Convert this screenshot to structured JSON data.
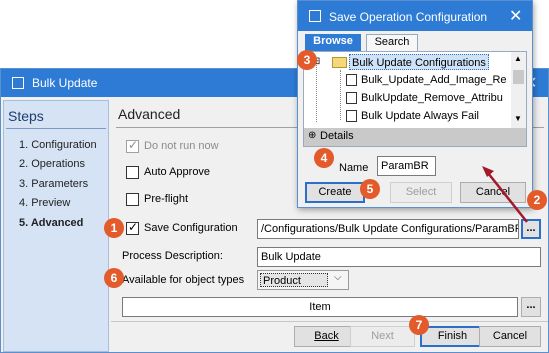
{
  "main_window": {
    "title": "Bulk Update",
    "steps": {
      "title": "Steps",
      "items": [
        "1. Configuration",
        "2. Operations",
        "3. Parameters",
        "4. Preview",
        "5. Advanced"
      ]
    },
    "section_title": "Advanced",
    "do_not_run_now": "Do not run now",
    "auto_approve": "Auto Approve",
    "pre_flight": "Pre-flight",
    "save_configuration": "Save Configuration",
    "config_path": "/Configurations/Bulk Update Configurations/ParamBR",
    "browse_button": "...",
    "process_description_label": "Process Description:",
    "process_description_value": "Bulk Update",
    "available_for_label": "Available for object types",
    "object_type_selected": "Product",
    "item_value": "Item",
    "item_browse_button": "...",
    "buttons": {
      "back": "Back",
      "next": "Next",
      "finish": "Finish",
      "cancel": "Cancel"
    }
  },
  "dialog": {
    "title": "Save Operation Configuration",
    "tabs": [
      "Browse",
      "Search"
    ],
    "tree": {
      "folder": "Bulk Update Configurations",
      "items": [
        "Bulk_Update_Add_Image_Re",
        "BulkUpdate_Remove_Attribu",
        "Bulk Update Always Fail"
      ],
      "details": "Details"
    },
    "name_label": "Name",
    "name_value": "ParamBR",
    "buttons": {
      "create": "Create",
      "select": "Select",
      "cancel": "Cancel"
    }
  },
  "markers": [
    "1",
    "2",
    "3",
    "4",
    "5",
    "6",
    "7"
  ],
  "icons": {
    "window": "window-icon",
    "close": "close-icon",
    "folder": "folder-icon",
    "file": "file-icon",
    "check": "check-icon",
    "dropdown": "chevron-down-icon"
  },
  "colors": {
    "titlebar": "#2e7bd6",
    "marker": "#e35a2b",
    "arrow": "#a3182a",
    "steps_panel": "#d5e3f4",
    "selection": "#cfe3f8"
  }
}
